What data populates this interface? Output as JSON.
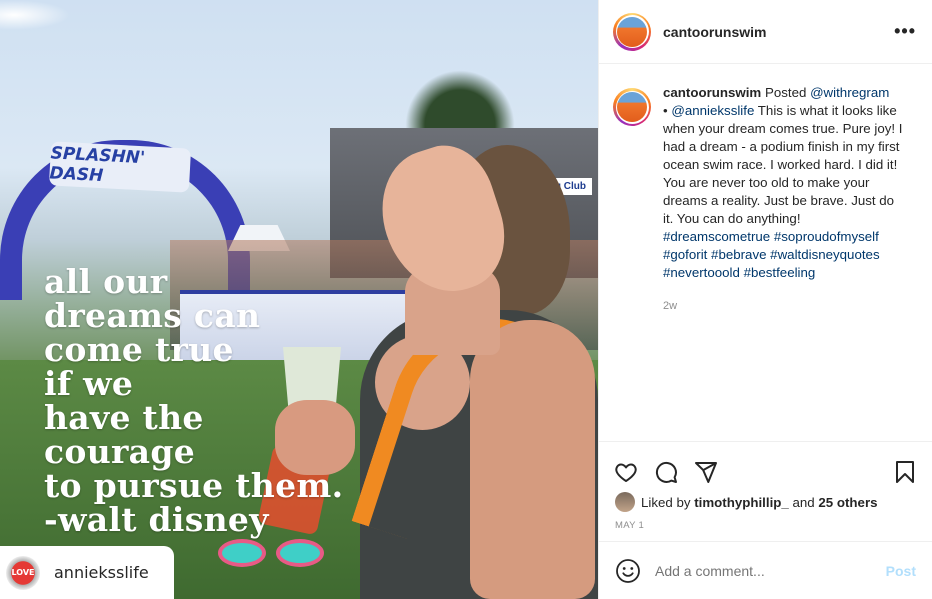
{
  "photo": {
    "banner_text": "SPLASHN' DASH",
    "club_sign": "ing Club",
    "quote": "all our\ndreams can\ncome true\nif we\nhave the\ncourage\nto pursue them.\n-walt disney",
    "repost_avatar_text": "LOVE",
    "repost_username": "annieksslife"
  },
  "header": {
    "username": "cantoorunswim",
    "more_label": "•••"
  },
  "caption": {
    "username": "cantoorunswim",
    "posted": " Posted ",
    "via": "@withregram",
    "bullet": "• ",
    "mention": "@annieksslife",
    "body": " This is what it looks like when your dream comes true. Pure joy! I had a dream - a podium finish in my first ocean swim race. I worked hard. I did it! You are never too old to make your dreams a reality. Just be brave. Just do it. You can do anything! ",
    "hashtags": "#dreamscometrue #soproudofmyself #goforit #bebrave #waltdisneyquotes #nevertooold #bestfeeling",
    "age": "2w"
  },
  "actions": {
    "icons": [
      "heart-icon",
      "comment-icon",
      "share-icon",
      "bookmark-icon"
    ],
    "liked_by_prefix": "Liked by ",
    "liked_by_user": "timothyphillip_",
    "liked_by_and": " and ",
    "liked_by_others": "25 others",
    "date": "MAY 1"
  },
  "comment": {
    "placeholder": "Add a comment...",
    "post_label": "Post"
  },
  "colors": {
    "link": "#00376b",
    "muted": "#8e8e8e",
    "post_disabled": "#b2dffc"
  }
}
